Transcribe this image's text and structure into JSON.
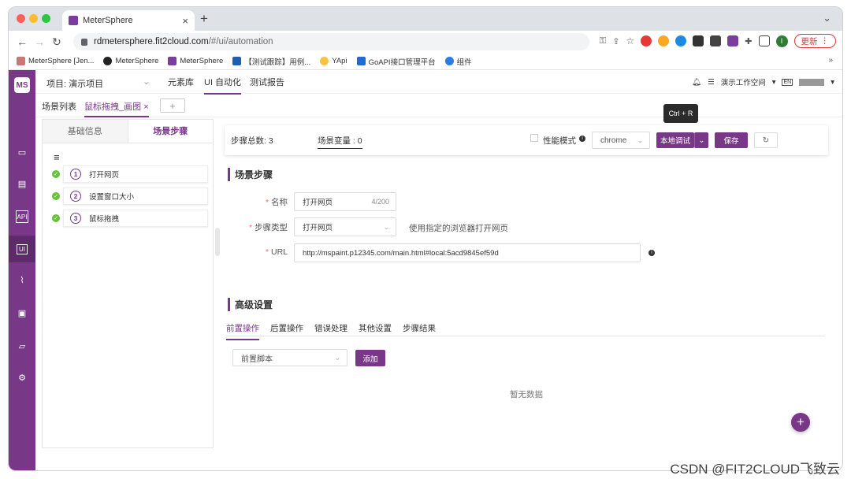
{
  "browser": {
    "tab_title": "MeterSphere",
    "url_main": "rdmetersphere.fit2cloud.com",
    "url_rest": "/#/ui/automation",
    "update_label": "更新",
    "bookmarks": [
      "MeterSphere [Jen...",
      "MeterSphere",
      "MeterSphere",
      "【测试跟踪】用例...",
      "YApi",
      "GoAPI接口管理平台",
      "组件"
    ]
  },
  "topnav": {
    "project": "项目: 演示项目",
    "items": [
      "元素库",
      "UI 自动化",
      "测试报告"
    ],
    "workspace": "演示工作空间",
    "lang": "EN"
  },
  "subtabs": {
    "list_label": "场景列表",
    "active_label": "鼠标拖拽_画图"
  },
  "left_panel": {
    "tabs": [
      "基础信息",
      "场景步骤"
    ],
    "steps": [
      {
        "num": "1",
        "label": "打开网页"
      },
      {
        "num": "2",
        "label": "设置窗口大小"
      },
      {
        "num": "3",
        "label": "鼠标拖拽"
      }
    ]
  },
  "toolbar": {
    "step_total": "步骤总数: 3",
    "scene_vars": "场景变量 : 0",
    "perf_mode": "性能模式",
    "browser": "chrome",
    "debug": "本地调试",
    "save": "保存",
    "tooltip": "Ctrl + R"
  },
  "scene_steps": {
    "title": "场景步骤",
    "name_label": "名称",
    "name_value": "打开网页",
    "name_count": "4/200",
    "type_label": "步骤类型",
    "type_value": "打开网页",
    "type_hint": "使用指定的浏览器打开网页",
    "url_label": "URL",
    "url_value": "http://mspaint.p12345.com/main.html#local:5acd9845ef59d"
  },
  "advanced": {
    "title": "高级设置",
    "tabs": [
      "前置操作",
      "后置操作",
      "错误处理",
      "其他设置",
      "步骤结果"
    ],
    "script_select": "前置脚本",
    "add": "添加",
    "empty": "暂无数据"
  },
  "watermark": "CSDN @FIT2CLOUD飞致云",
  "colors": {
    "brand": "#783887",
    "success": "#67c23a"
  }
}
